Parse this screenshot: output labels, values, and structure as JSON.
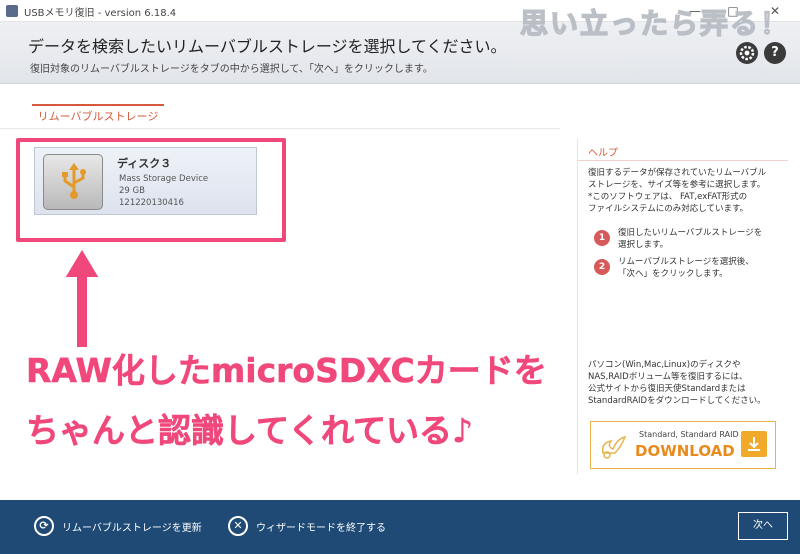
{
  "window": {
    "title": "USBメモリ復旧 - version 6.18.4",
    "minimize": "—",
    "maximize": "□",
    "close": "✕"
  },
  "watermark": "思い立ったら弄る！",
  "header": {
    "title": "データを検索したいリムーバブルストレージを選択してください。",
    "subtitle": "復旧対象のリムーバブルストレージをタブの中から選択して、「次へ」をクリックします。",
    "settings_icon": "gear-icon",
    "help_label": "?"
  },
  "tabs": [
    {
      "label": "リムーバブルストレージ",
      "active": true
    }
  ],
  "disk": {
    "name": "ディスク３",
    "type": "Mass Storage Device",
    "size": "29 GB",
    "serial": "121220130416"
  },
  "annotation": {
    "line1": "RAW化したmicroSDXCカードを",
    "line2": "ちゃんと認識してくれている♪",
    "color": "#f0487a"
  },
  "help": {
    "title": "ヘルプ",
    "lines": [
      "復旧するデータが保存されていたリムーバブル",
      "ストレージを、サイズ等を参考に選択します。",
      "*このソフトウェアは、 FAT,exFAT形式の",
      "ファイルシステムにのみ対応しています。"
    ],
    "steps": [
      {
        "num": "1",
        "lines": [
          "復旧したいリムーバブルストレージを",
          "選択します。"
        ]
      },
      {
        "num": "2",
        "lines": [
          "リムーバブルストレージを選択後、",
          "「次へ」をクリックします。"
        ]
      }
    ],
    "promo_lines": [
      "パソコン(Win,Mac,Linux)のディスクや",
      "NAS,RAIDボリューム等を復旧するには、",
      "公式サイトから復旧天使Standardまたは",
      "StandardRAIDをダウンロードしてください。"
    ]
  },
  "download": {
    "small": "Standard, Standard RAID",
    "big": "DOWNLOAD",
    "accent": "#f0a928"
  },
  "bottombar": {
    "refresh_label": "リムーバブルストレージを更新",
    "exit_label": "ウィザードモードを終了する",
    "next_label": "次へ",
    "bg": "#1e4a75"
  }
}
